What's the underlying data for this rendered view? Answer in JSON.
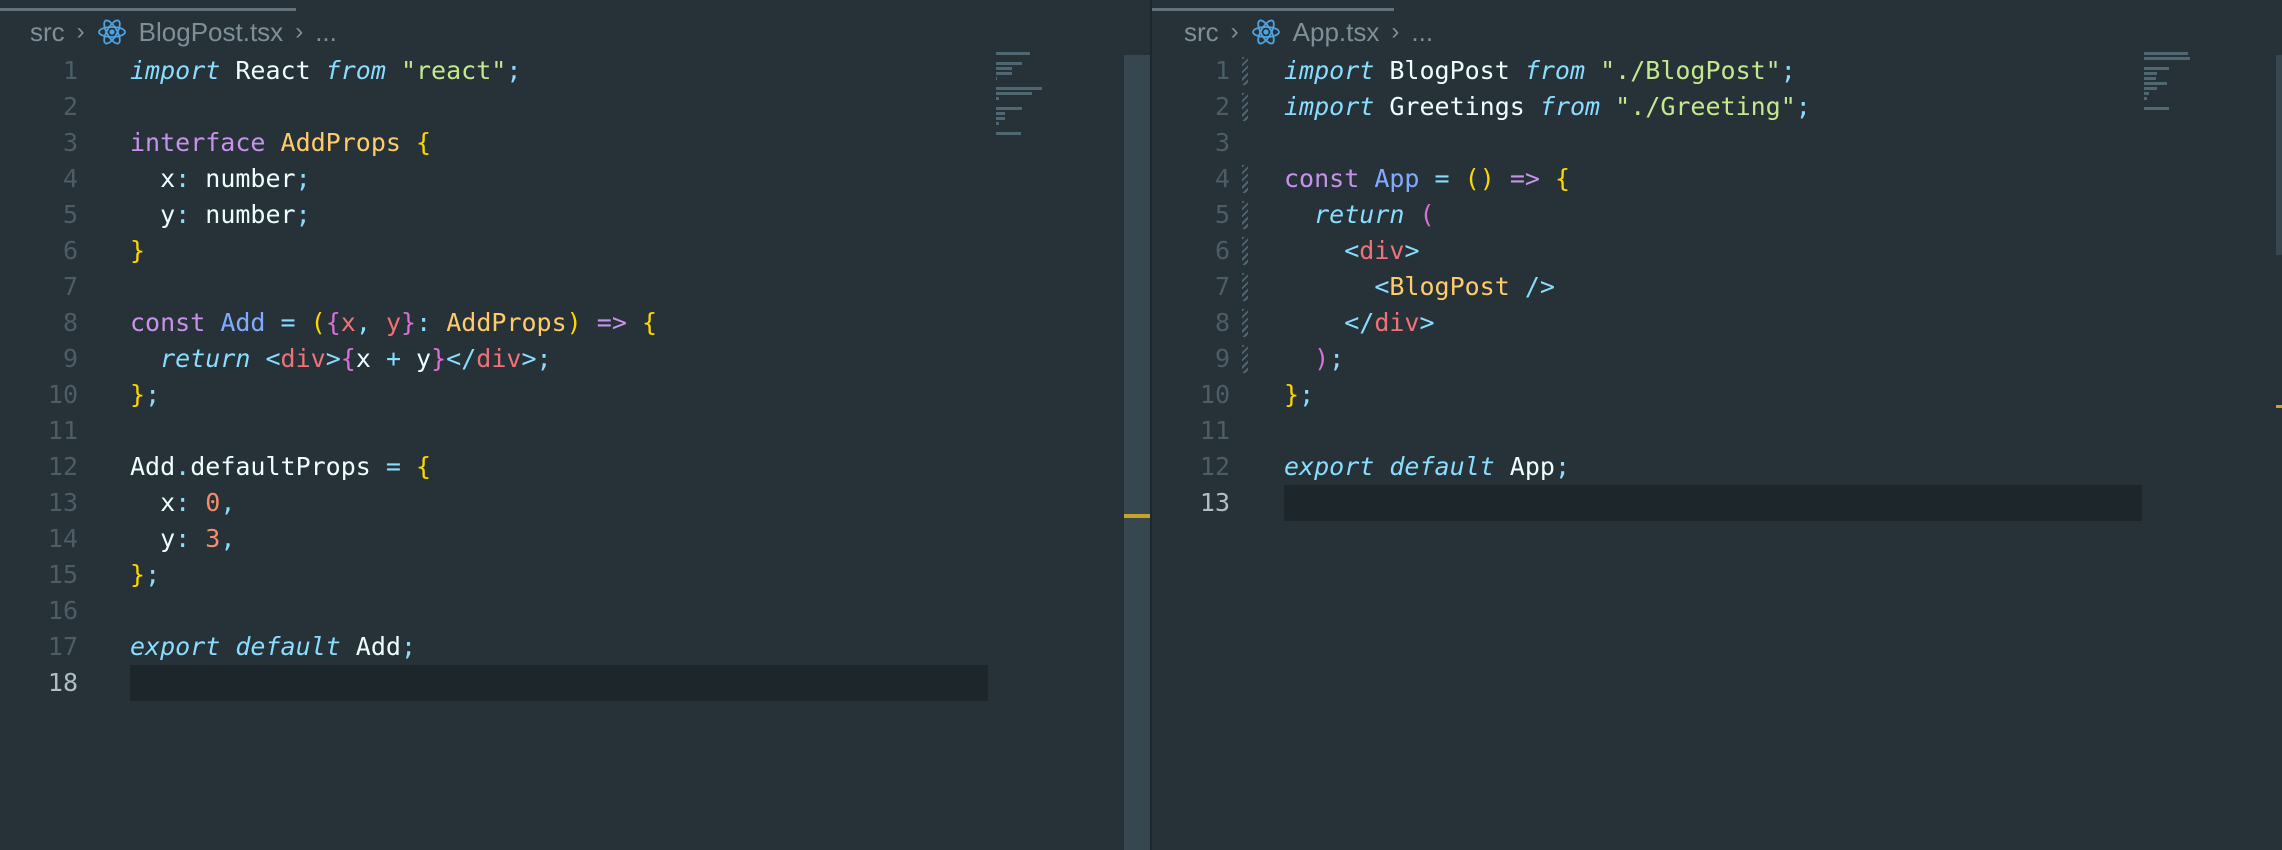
{
  "left_editor": {
    "breadcrumb": {
      "folder": "src",
      "file": "BlogPost.tsx",
      "ellipsis": "..."
    },
    "lines": [
      {
        "n": "1",
        "t": [
          [
            "kw-i",
            "import"
          ],
          [
            "pl",
            " React "
          ],
          [
            "kw-i",
            "from"
          ],
          [
            "pl",
            " "
          ],
          [
            "str",
            "\"react\""
          ],
          [
            "pun",
            ";"
          ]
        ]
      },
      {
        "n": "2",
        "t": []
      },
      {
        "n": "3",
        "t": [
          [
            "kw",
            "interface"
          ],
          [
            "pl",
            " "
          ],
          [
            "ty",
            "AddProps"
          ],
          [
            "pl",
            " "
          ],
          [
            "br1",
            "{"
          ]
        ]
      },
      {
        "n": "4",
        "t": [
          [
            "pl",
            "  x"
          ],
          [
            "pun",
            ":"
          ],
          [
            "pl",
            " number"
          ],
          [
            "pun",
            ";"
          ]
        ]
      },
      {
        "n": "5",
        "t": [
          [
            "pl",
            "  y"
          ],
          [
            "pun",
            ":"
          ],
          [
            "pl",
            " number"
          ],
          [
            "pun",
            ";"
          ]
        ]
      },
      {
        "n": "6",
        "t": [
          [
            "br1",
            "}"
          ]
        ]
      },
      {
        "n": "7",
        "t": []
      },
      {
        "n": "8",
        "t": [
          [
            "kw",
            "const"
          ],
          [
            "pl",
            " "
          ],
          [
            "fn",
            "Add"
          ],
          [
            "pl",
            " "
          ],
          [
            "pun",
            "="
          ],
          [
            "pl",
            " "
          ],
          [
            "br1",
            "("
          ],
          [
            "br2",
            "{"
          ],
          [
            "var",
            "x"
          ],
          [
            "pun",
            ","
          ],
          [
            "pl",
            " "
          ],
          [
            "var",
            "y"
          ],
          [
            "br2",
            "}"
          ],
          [
            "pun",
            ":"
          ],
          [
            "pl",
            " "
          ],
          [
            "ty",
            "AddProps"
          ],
          [
            "br1",
            ")"
          ],
          [
            "pl",
            " "
          ],
          [
            "kw",
            "=>"
          ],
          [
            "pl",
            " "
          ],
          [
            "br1",
            "{"
          ]
        ]
      },
      {
        "n": "9",
        "t": [
          [
            "pl",
            "  "
          ],
          [
            "kw-i",
            "return"
          ],
          [
            "pl",
            " "
          ],
          [
            "pun",
            "<"
          ],
          [
            "tag",
            "div"
          ],
          [
            "pun",
            ">"
          ],
          [
            "br2",
            "{"
          ],
          [
            "pl",
            "x "
          ],
          [
            "pun",
            "+"
          ],
          [
            "pl",
            " y"
          ],
          [
            "br2",
            "}"
          ],
          [
            "pun",
            "</"
          ],
          [
            "tag",
            "div"
          ],
          [
            "pun",
            ">"
          ],
          [
            "pun",
            ";"
          ]
        ]
      },
      {
        "n": "10",
        "t": [
          [
            "br1",
            "}"
          ],
          [
            "pun",
            ";"
          ]
        ]
      },
      {
        "n": "11",
        "t": []
      },
      {
        "n": "12",
        "t": [
          [
            "pl",
            "Add"
          ],
          [
            "pun",
            "."
          ],
          [
            "pl",
            "defaultProps "
          ],
          [
            "pun",
            "="
          ],
          [
            "pl",
            " "
          ],
          [
            "br1",
            "{"
          ]
        ]
      },
      {
        "n": "13",
        "t": [
          [
            "pl",
            "  x"
          ],
          [
            "pun",
            ":"
          ],
          [
            "pl",
            " "
          ],
          [
            "num",
            "0"
          ],
          [
            "pun",
            ","
          ]
        ]
      },
      {
        "n": "14",
        "t": [
          [
            "pl",
            "  y"
          ],
          [
            "pun",
            ":"
          ],
          [
            "pl",
            " "
          ],
          [
            "num",
            "3"
          ],
          [
            "pun",
            ","
          ]
        ]
      },
      {
        "n": "15",
        "t": [
          [
            "br1",
            "}"
          ],
          [
            "pun",
            ";"
          ]
        ]
      },
      {
        "n": "16",
        "t": []
      },
      {
        "n": "17",
        "t": [
          [
            "kw-i",
            "export"
          ],
          [
            "pl",
            " "
          ],
          [
            "kw-i",
            "default"
          ],
          [
            "pl",
            " Add"
          ],
          [
            "pun",
            ";"
          ]
        ]
      },
      {
        "n": "18",
        "t": [],
        "active": true
      }
    ]
  },
  "right_editor": {
    "breadcrumb": {
      "folder": "src",
      "file": "App.tsx",
      "ellipsis": "..."
    },
    "lines": [
      {
        "n": "1",
        "t": [
          [
            "kw-i",
            "import"
          ],
          [
            "pl",
            " BlogPost "
          ],
          [
            "kw-i",
            "from"
          ],
          [
            "pl",
            " "
          ],
          [
            "str",
            "\"./BlogPost\""
          ],
          [
            "pun",
            ";"
          ]
        ]
      },
      {
        "n": "2",
        "t": [
          [
            "kw-i",
            "import"
          ],
          [
            "pl",
            " Greetings "
          ],
          [
            "kw-i",
            "from"
          ],
          [
            "pl",
            " "
          ],
          [
            "str",
            "\"./Greeting\""
          ],
          [
            "pun",
            ";"
          ]
        ]
      },
      {
        "n": "3",
        "t": []
      },
      {
        "n": "4",
        "t": [
          [
            "kw",
            "const"
          ],
          [
            "pl",
            " "
          ],
          [
            "fn",
            "App"
          ],
          [
            "pl",
            " "
          ],
          [
            "pun",
            "="
          ],
          [
            "pl",
            " "
          ],
          [
            "br1",
            "()"
          ],
          [
            "pl",
            " "
          ],
          [
            "kw",
            "=>"
          ],
          [
            "pl",
            " "
          ],
          [
            "br1",
            "{"
          ]
        ]
      },
      {
        "n": "5",
        "t": [
          [
            "pl",
            "  "
          ],
          [
            "kw-i",
            "return"
          ],
          [
            "pl",
            " "
          ],
          [
            "br2",
            "("
          ]
        ]
      },
      {
        "n": "6",
        "t": [
          [
            "pl",
            "    "
          ],
          [
            "pun",
            "<"
          ],
          [
            "tag",
            "div"
          ],
          [
            "pun",
            ">"
          ]
        ]
      },
      {
        "n": "7",
        "t": [
          [
            "pl",
            "      "
          ],
          [
            "pun",
            "<"
          ],
          [
            "ty",
            "BlogPost"
          ],
          [
            "pl",
            " "
          ],
          [
            "pun",
            "/>"
          ]
        ]
      },
      {
        "n": "8",
        "t": [
          [
            "pl",
            "    "
          ],
          [
            "pun",
            "</"
          ],
          [
            "tag",
            "div"
          ],
          [
            "pun",
            ">"
          ]
        ]
      },
      {
        "n": "9",
        "t": [
          [
            "pl",
            "  "
          ],
          [
            "br2",
            ")"
          ],
          [
            "pun",
            ";"
          ]
        ]
      },
      {
        "n": "10",
        "t": [
          [
            "br1",
            "}"
          ],
          [
            "pun",
            ";"
          ]
        ]
      },
      {
        "n": "11",
        "t": []
      },
      {
        "n": "12",
        "t": [
          [
            "kw-i",
            "export"
          ],
          [
            "pl",
            " "
          ],
          [
            "kw-i",
            "default"
          ],
          [
            "pl",
            " App"
          ],
          [
            "pun",
            ";"
          ]
        ]
      },
      {
        "n": "13",
        "t": [],
        "active": true
      }
    ]
  }
}
